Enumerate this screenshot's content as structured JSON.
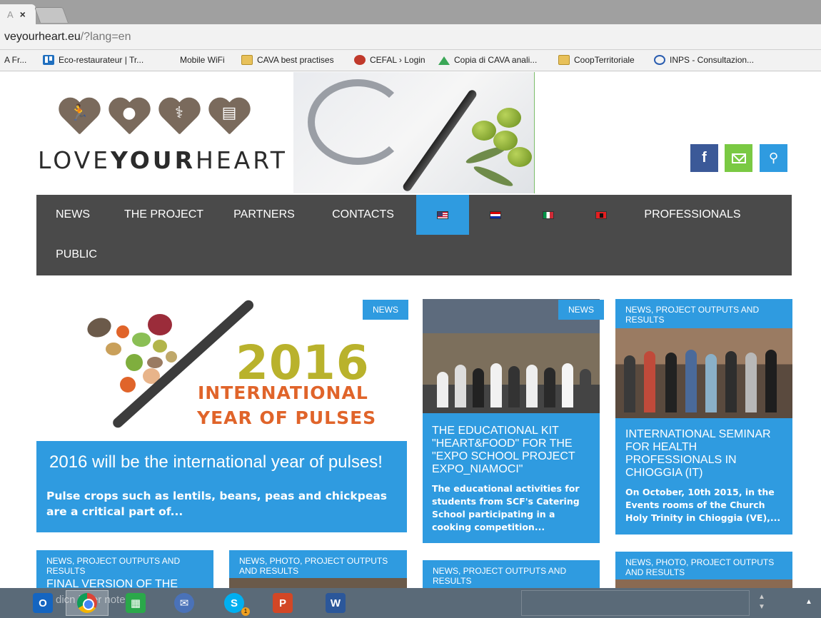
{
  "browser": {
    "tab_title": "A",
    "tab_close": "×",
    "url_host": "veyourheart.eu",
    "url_path": "/?lang=en",
    "bookmarks": [
      {
        "label": "A Fr...",
        "icon": "none"
      },
      {
        "label": "Eco-restaurateur | Tr...",
        "icon": "trello-icon"
      },
      {
        "label": "Mobile WiFi",
        "icon": "none"
      },
      {
        "label": "CAVA best practises",
        "icon": "folder-icon"
      },
      {
        "label": "CEFAL › Login",
        "icon": "cefal-icon"
      },
      {
        "label": "Copia di CAVA anali...",
        "icon": "drive-icon"
      },
      {
        "label": "CoopTerritoriale",
        "icon": "folder-icon"
      },
      {
        "label": "INPS - Consultazion...",
        "icon": "inps-icon"
      }
    ]
  },
  "site": {
    "logo": {
      "pre": "LOVE",
      "bold": "YOUR",
      "post": "HEART"
    },
    "social": {
      "facebook": "f",
      "search": "⚲"
    },
    "nav": [
      {
        "label": "NEWS"
      },
      {
        "label": "THE PROJECT"
      },
      {
        "label": "PARTNERS"
      },
      {
        "label": "CONTACTS"
      },
      {
        "label": "",
        "flag": "us",
        "active": true
      },
      {
        "label": "",
        "flag": "hr"
      },
      {
        "label": "",
        "flag": "it"
      },
      {
        "label": "",
        "flag": "al"
      },
      {
        "label": "PROFESSIONALS"
      },
      {
        "label": "PUBLIC"
      }
    ]
  },
  "featured": {
    "badge": "NEWS",
    "image_text": {
      "year": "2016",
      "line1": "INTERNATIONAL",
      "line2": "YEAR OF PULSES"
    },
    "title": "2016 will be the international year of pulses!",
    "excerpt": "Pulse crops such as lentils, beans, peas and chickpeas are a critical part of..."
  },
  "card2": {
    "badge": "NEWS",
    "title": "THE EDUCATIONAL KIT \"HEART&FOOD\" FOR THE \"EXPO SCHOOL PROJECT EXPO_NIAMOCI\"",
    "excerpt": "The educational activities for students from SCF's Catering School participating in a cooking competition..."
  },
  "card3": {
    "badge": "NEWS, PROJECT OUTPUTS AND RESULTS",
    "title": "INTERNATIONAL SEMINAR FOR HEALTH PROFESSIONALS IN CHIOGGIA (IT)",
    "excerpt": "On October, 10th 2015, in the Events rooms of the Church Holy Trinity in Chioggia (VE),..."
  },
  "row2": [
    {
      "badge": "NEWS, PROJECT OUTPUTS AND RESULTS",
      "title": "FINAL VERSION OF THE"
    },
    {
      "badge": "NEWS, PHOTO, PROJECT OUTPUTS AND RESULTS"
    },
    {
      "badge": "NEWS, PROJECT OUTPUTS AND RESULTS"
    },
    {
      "badge": "NEWS, PHOTO, PROJECT OUTPUTS AND RESULTS"
    }
  ],
  "taskbar": {
    "overlay_text": "ce dicn inser  note",
    "skype_badge": "1",
    "apps": [
      "outlook-icon",
      "chrome-icon",
      "store-icon",
      "thunderbird-icon",
      "skype-icon",
      "powerpoint-icon",
      "word-icon"
    ],
    "labels": {
      "outlook": "O",
      "skype": "S",
      "powerpoint": "P",
      "word": "W"
    }
  }
}
